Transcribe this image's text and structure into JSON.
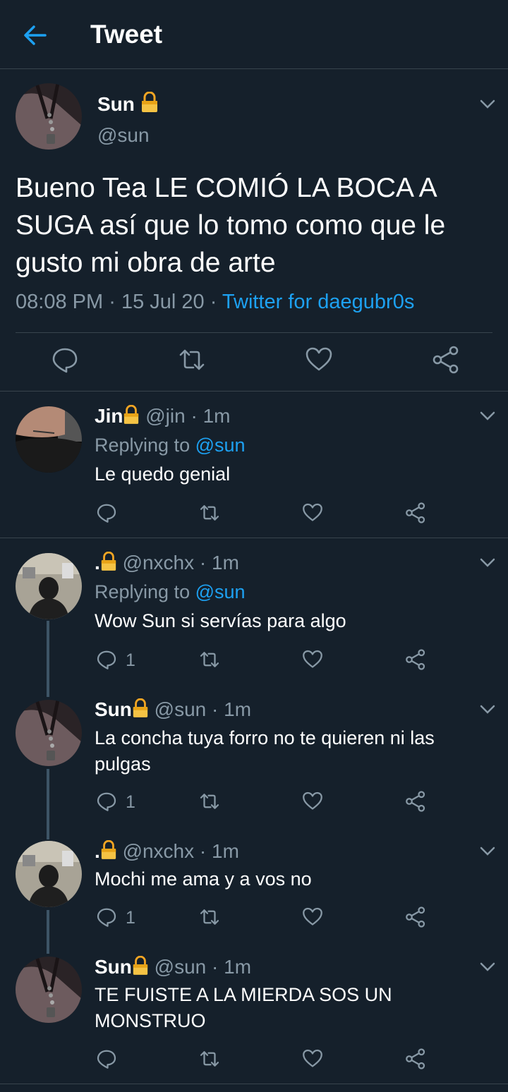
{
  "header": {
    "title": "Tweet",
    "back_icon": "back-arrow-icon"
  },
  "colors": {
    "background": "#15202b",
    "accent": "#1da1f2",
    "muted": "#8899a6",
    "divider": "#38444d"
  },
  "main_tweet": {
    "name": "Sun",
    "handle": "@sun",
    "text": "Bueno Tea LE COMIÓ LA BOCA A SUGA así que lo tomo como que le gusto mi obra de arte",
    "time": "08:08 PM",
    "date": "15 Jul 20",
    "sep": "·",
    "source": "Twitter for daegubr0s"
  },
  "replies": [
    {
      "name": "Jin",
      "handle": "@jin",
      "time": "1m",
      "replying_label": "Replying to",
      "replying_to": "@sun",
      "text": "Le quedo genial",
      "reply_count": ""
    },
    {
      "name": ".",
      "handle": "@nxchx",
      "time": "1m",
      "replying_label": "Replying to",
      "replying_to": "@sun",
      "text": "Wow Sun si servías para algo",
      "reply_count": "1"
    },
    {
      "name": "Sun",
      "handle": "@sun",
      "time": "1m",
      "text": "La concha tuya forro no te quieren ni las pulgas",
      "reply_count": "1"
    },
    {
      "name": ".",
      "handle": "@nxchx",
      "time": "1m",
      "text": "Mochi me ama y a vos no",
      "reply_count": "1"
    },
    {
      "name": "Sun",
      "handle": "@sun",
      "time": "1m",
      "text": "TE FUISTE A LA MIERDA SOS UN MONSTRUO",
      "reply_count": ""
    }
  ],
  "dot_sep": "·"
}
